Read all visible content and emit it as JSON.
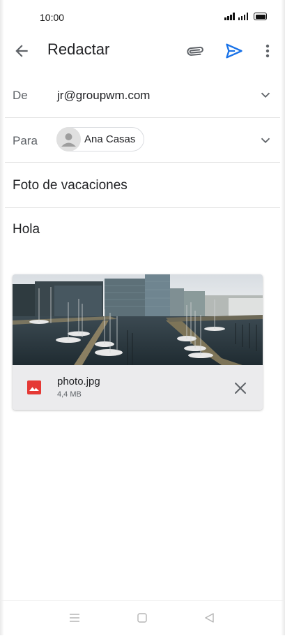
{
  "status_bar": {
    "time": "10:00"
  },
  "app_bar": {
    "title": "Redactar"
  },
  "compose": {
    "from_label": "De",
    "from_value": "jr@groupwm.com",
    "to_label": "Para",
    "recipient_name": "Ana Casas",
    "subject": "Foto de vacaciones",
    "body": "Hola"
  },
  "attachment": {
    "file_name": "photo.jpg",
    "file_size": "4,4 MB",
    "icon": "image-file-icon"
  },
  "colors": {
    "send_accent": "#1a73e8",
    "image_icon": "#e53935",
    "icon_gray": "#5f6368"
  },
  "icons": [
    "back-arrow-icon",
    "paperclip-icon",
    "send-icon",
    "more-vert-icon",
    "chevron-down-icon",
    "close-icon",
    "nav-menu-icon",
    "nav-home-icon",
    "nav-back-icon"
  ]
}
